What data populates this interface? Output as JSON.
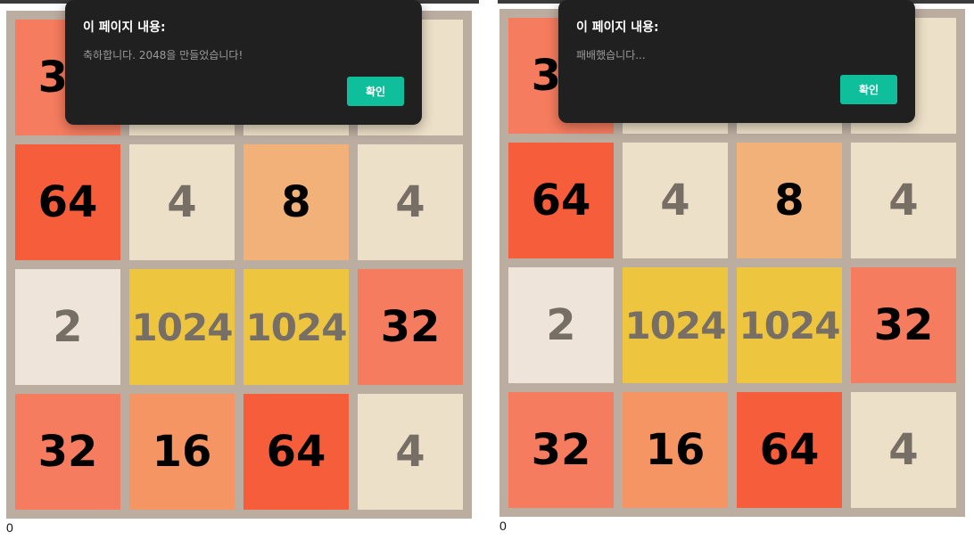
{
  "colors": {
    "board_bg": "#bbada0",
    "dialog_bg": "#202020",
    "ok_button": "#0fbf9c",
    "dark_text": "#776e65",
    "light_text": "#000000"
  },
  "tile_colors": {
    "2": "#eee4da",
    "4": "#ede0c8",
    "8": "#f2b179",
    "16": "#f59563",
    "32": "#f67c5f",
    "64": "#f65e3b",
    "1024": "#edc53f"
  },
  "panels": [
    {
      "score": "0",
      "grid": [
        [
          "32",
          "",
          "",
          ""
        ],
        [
          "64",
          "4",
          "8",
          "4"
        ],
        [
          "2",
          "1024",
          "1024",
          "32"
        ],
        [
          "32",
          "16",
          "64",
          "4"
        ]
      ],
      "dialog": {
        "title": "이 페이지 내용:",
        "message": "축하합니다. 2048을 만들었습니다!",
        "ok_label": "확인"
      }
    },
    {
      "score": "0",
      "grid": [
        [
          "32",
          "",
          "",
          ""
        ],
        [
          "64",
          "4",
          "8",
          "4"
        ],
        [
          "2",
          "1024",
          "1024",
          "32"
        ],
        [
          "32",
          "16",
          "64",
          "4"
        ]
      ],
      "dialog": {
        "title": "이 페이지 내용:",
        "message": "패배했습니다...",
        "ok_label": "확인"
      }
    }
  ]
}
